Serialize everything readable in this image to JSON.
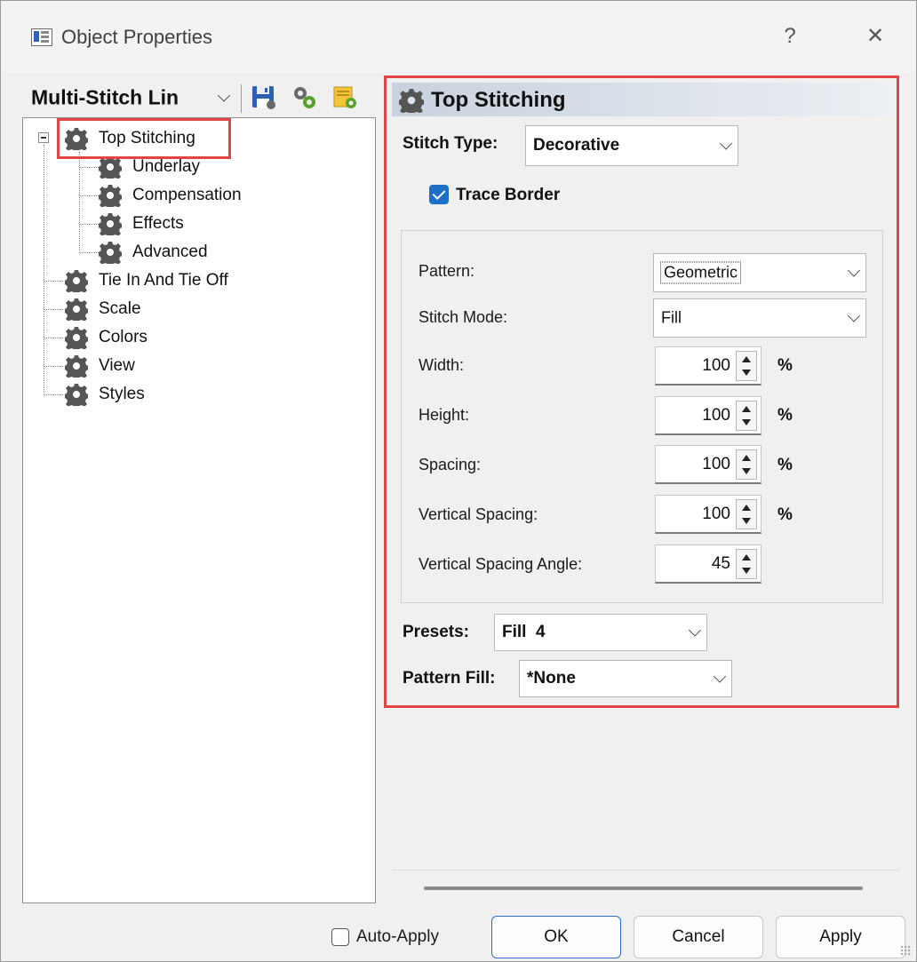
{
  "window": {
    "title": "Object Properties",
    "help_glyph": "?",
    "close_glyph": "✕"
  },
  "tree_combo": {
    "value": "Multi-Stitch Lin"
  },
  "toolbar": {
    "icons": [
      "save-icon",
      "gears-icon",
      "apply-gear-icon"
    ]
  },
  "tree": {
    "items": [
      {
        "label": "Top Stitching",
        "level": 0,
        "selected": true
      },
      {
        "label": "Underlay",
        "level": 1
      },
      {
        "label": "Compensation",
        "level": 1
      },
      {
        "label": "Effects",
        "level": 1
      },
      {
        "label": "Advanced",
        "level": 1
      },
      {
        "label": "Tie In And Tie Off",
        "level": 0
      },
      {
        "label": "Scale",
        "level": 0
      },
      {
        "label": "Colors",
        "level": 0
      },
      {
        "label": "View",
        "level": 0
      },
      {
        "label": "Styles",
        "level": 0
      }
    ]
  },
  "panel": {
    "header": "Top Stitching",
    "stitch_type": {
      "label": "Stitch Type:",
      "value": "Decorative"
    },
    "trace_border": {
      "label": "Trace Border",
      "checked": true
    },
    "pattern": {
      "label": "Pattern:",
      "value": "Geometric"
    },
    "stitch_mode": {
      "label": "Stitch Mode:",
      "value": "Fill"
    },
    "width": {
      "label": "Width:",
      "value": "100",
      "unit": "%"
    },
    "height": {
      "label": "Height:",
      "value": "100",
      "unit": "%"
    },
    "spacing": {
      "label": "Spacing:",
      "value": "100",
      "unit": "%"
    },
    "vertical_spacing": {
      "label": "Vertical Spacing:",
      "value": "100",
      "unit": "%"
    },
    "vertical_spacing_angle": {
      "label": "Vertical Spacing Angle:",
      "value": "45"
    },
    "presets": {
      "label": "Presets:",
      "value": "Fill  4"
    },
    "pattern_fill": {
      "label": "Pattern Fill:",
      "value": "*None"
    }
  },
  "footer": {
    "auto_apply": {
      "label": "Auto-Apply",
      "checked": false
    },
    "ok": "OK",
    "cancel": "Cancel",
    "apply": "Apply"
  }
}
